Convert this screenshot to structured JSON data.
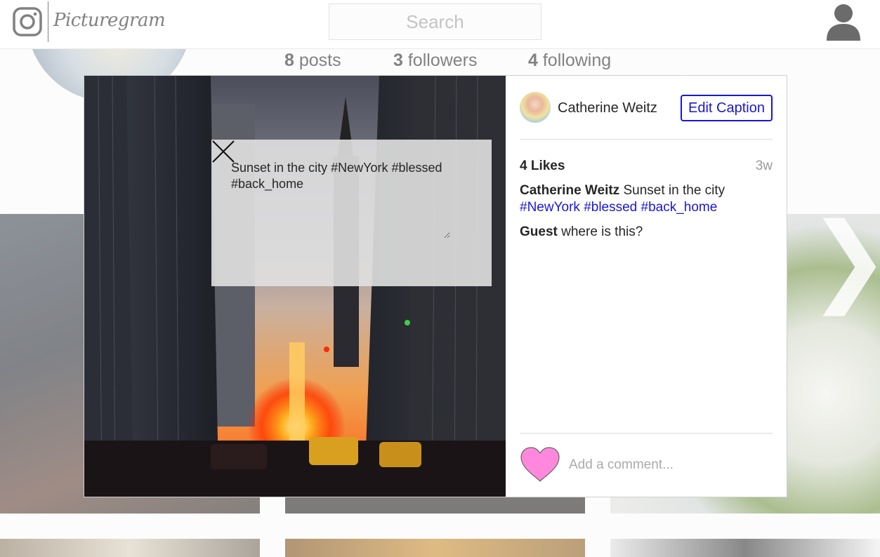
{
  "app": {
    "name": "Picturegram"
  },
  "header": {
    "search_placeholder": "Search"
  },
  "profile": {
    "posts_count": "8",
    "posts_label": "posts",
    "followers_count": "3",
    "followers_label": "followers",
    "following_count": "4",
    "following_label": "following"
  },
  "modal": {
    "author": "Catherine Weitz",
    "edit_caption_label": "Edit Caption",
    "caption_draft": "Sunset in the city #NewYork #blessed #back_home",
    "likes": "4 Likes",
    "age": "3w",
    "caption": {
      "user": "Catherine Weitz",
      "text": "Sunset in the city",
      "tags": [
        "#NewYork",
        "#blessed",
        "#back_home"
      ]
    },
    "comments": [
      {
        "user": "Guest",
        "text": "where is this?"
      }
    ],
    "add_comment_placeholder": "Add a comment..."
  },
  "colors": {
    "link": "#1a17d6",
    "heart": "#ff88dd",
    "muted": "#999999"
  },
  "icons": {
    "logo": "instagram-camera-icon",
    "user": "user-silhouette-icon",
    "close": "close-x-icon",
    "heart": "heart-icon",
    "next": "chevron-right-icon"
  }
}
